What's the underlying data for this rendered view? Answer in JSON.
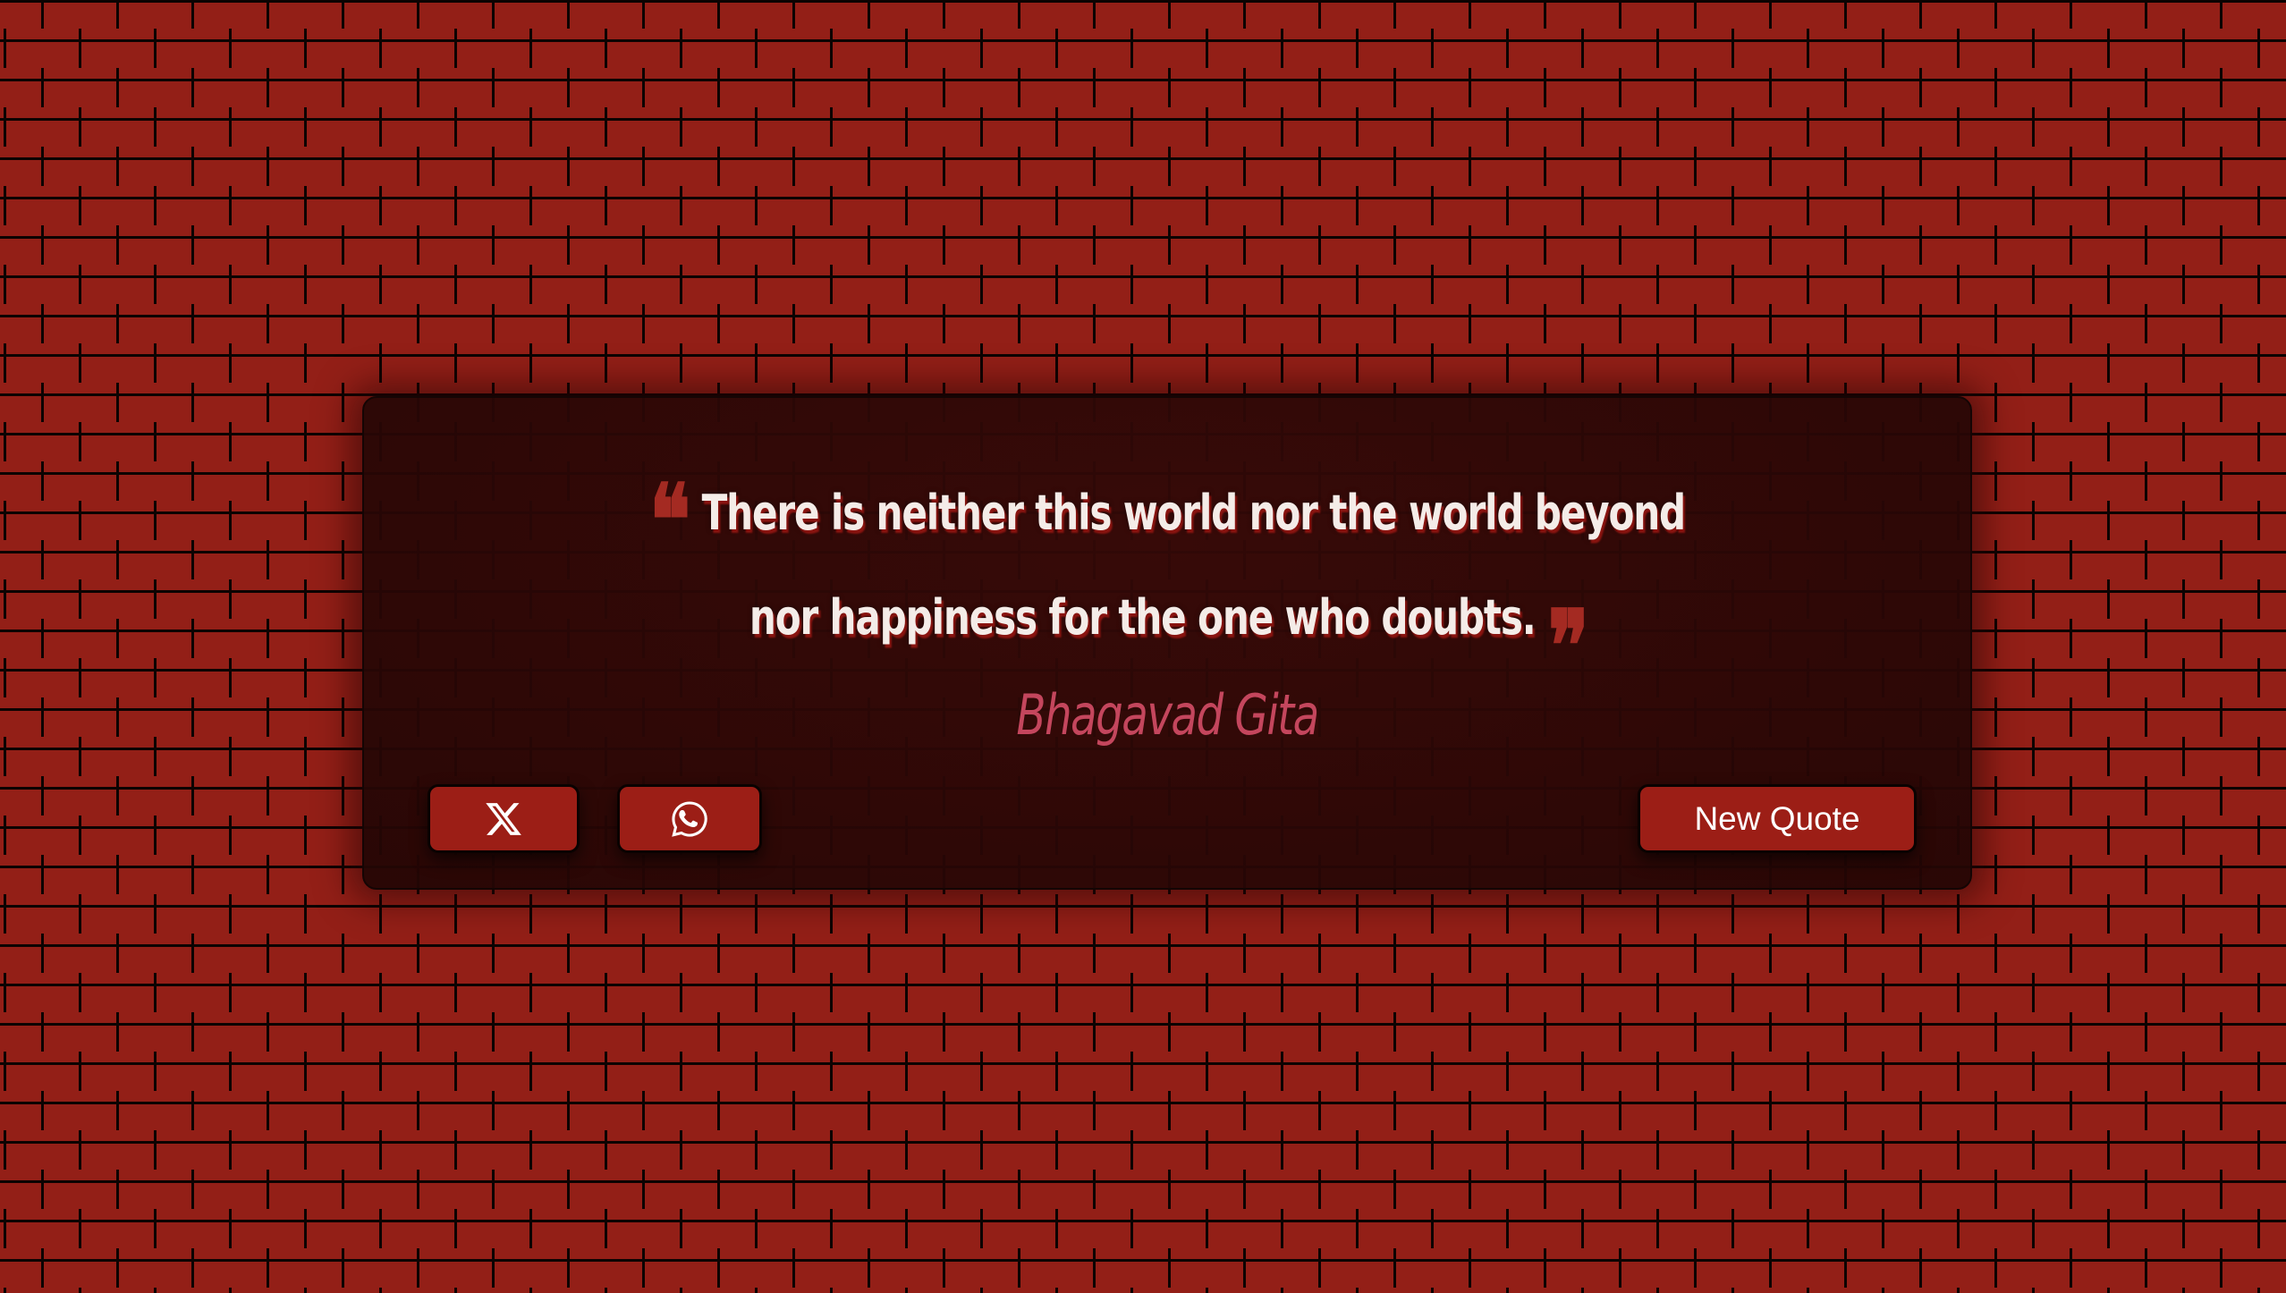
{
  "quote": {
    "text": "There is neither this world nor the world beyond nor happiness for the one who doubts.",
    "open_mark": "❝",
    "close_mark": "❞",
    "author": "Bhagavad Gita"
  },
  "actions": {
    "share_x_icon": "x-logo-icon",
    "share_whatsapp_icon": "whatsapp-icon",
    "new_quote_label": "New Quote"
  },
  "colors": {
    "background_brick": "#931f17",
    "mortar": "#0c0302",
    "card": "#28060a",
    "quote_text": "#f4ece8",
    "quote_mark": "#a42a22",
    "author": "#c4465d",
    "button": "#9c1e16"
  }
}
